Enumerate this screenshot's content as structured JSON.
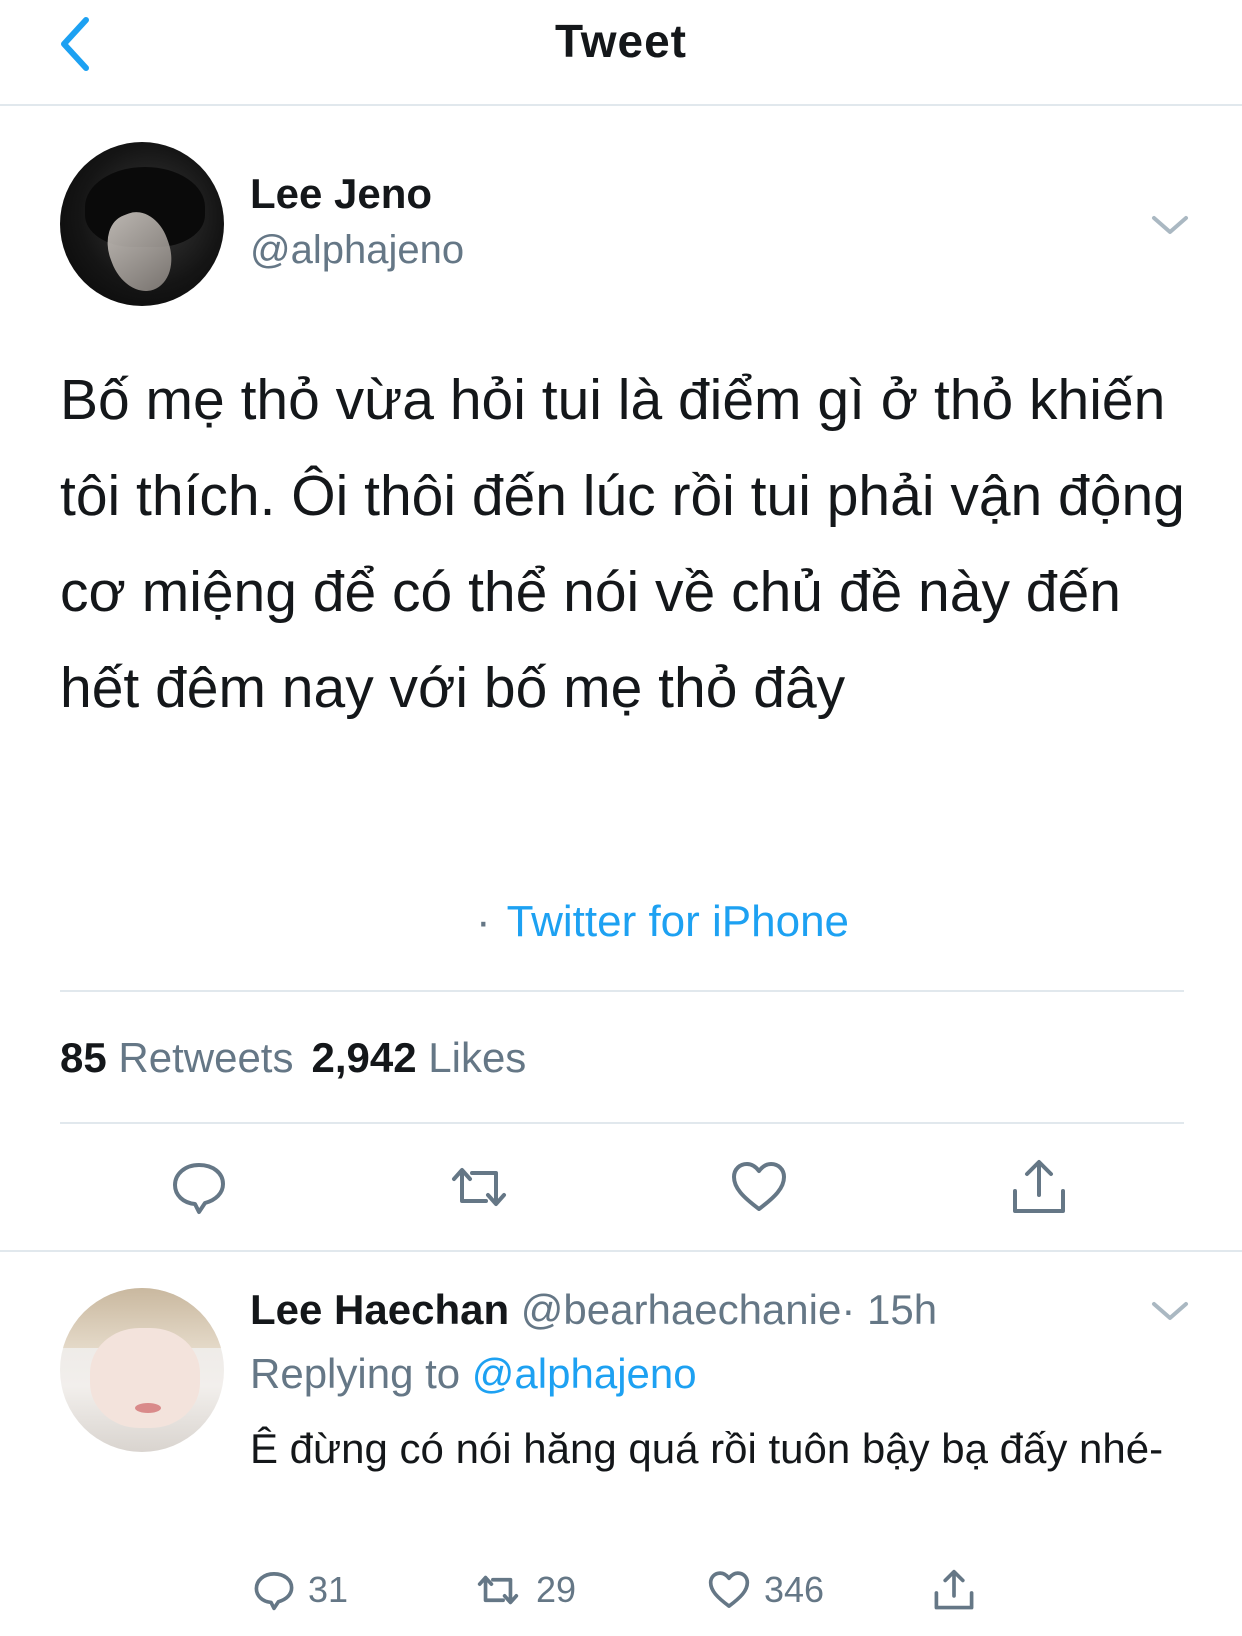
{
  "nav": {
    "title": "Tweet"
  },
  "tweet": {
    "author_name": "Lee Jeno",
    "author_handle": "@alphajeno",
    "text": "Bố mẹ thỏ vừa hỏi tui là điểm gì ở thỏ khiến tôi thích. Ôi thôi đến lúc rồi tui phải vận động cơ miệng để có thể nói về chủ đề này đến hết đêm nay với bố mẹ thỏ đây",
    "source_dot": "·",
    "source": "Twitter for iPhone",
    "retweets_count": "85",
    "retweets_label": "Retweets",
    "likes_count": "2,942",
    "likes_label": "Likes"
  },
  "reply": {
    "author_name": "Lee Haechan",
    "author_handle": "@bearhaechanie",
    "time": "· 15h",
    "replying_label": "Replying to",
    "replying_to": "@alphajeno",
    "text": "Ê đừng có nói hăng quá rồi tuôn bậy bạ đấy nhé-",
    "replies_count": "31",
    "retweets_count": "29",
    "likes_count": "346"
  },
  "icons": [
    "back-chevron-icon",
    "chevron-down-icon",
    "reply-icon",
    "retweet-icon",
    "like-icon",
    "share-icon"
  ],
  "colors": {
    "accent": "#1da1f2",
    "secondary_text": "#657786",
    "divider": "#e1e8ed"
  }
}
